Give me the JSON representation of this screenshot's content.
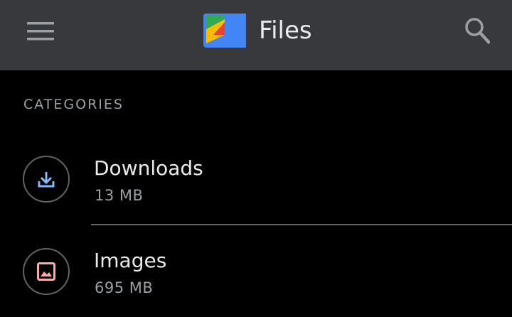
{
  "app_bar": {
    "title": "Files",
    "menu_icon": "hamburger-menu-icon",
    "logo_icon": "files-app-logo-icon",
    "search_icon": "search-icon",
    "background": "#38393c"
  },
  "categories": {
    "header": "CATEGORIES",
    "items": [
      {
        "title": "Downloads",
        "size": "13 MB",
        "icon": "download-icon",
        "icon_color": "#8ab4f8"
      },
      {
        "title": "Images",
        "size": "695 MB",
        "icon": "image-icon",
        "icon_color": "#f6aea9"
      }
    ]
  }
}
